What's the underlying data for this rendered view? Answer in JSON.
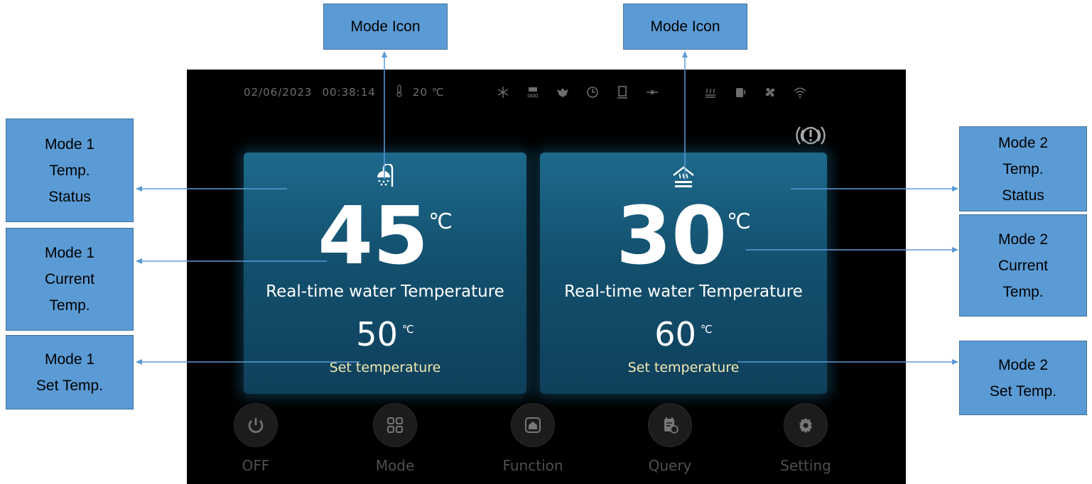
{
  "callouts": {
    "mode_icon_1": "Mode Icon",
    "mode_icon_2": "Mode Icon",
    "mode1_temp_status": "Mode 1\nTemp.\nStatus",
    "mode1_current_temp": "Mode 1\nCurrent\nTemp.",
    "mode1_set_temp": "Mode 1\nSet Temp.",
    "mode2_temp_status": "Mode 2\nTemp.\nStatus",
    "mode2_current_temp": "Mode 2\nCurrent\nTemp.",
    "mode2_set_temp": "Mode 2\nSet Temp."
  },
  "statusbar": {
    "date": "02/06/2023",
    "time": "00:38:14",
    "temp": "20 ℃"
  },
  "mode1": {
    "icon": "shower-icon",
    "current": "45",
    "current_unit": "℃",
    "realtime_label": "Real-time water Temperature",
    "set": "50",
    "set_unit": "℃",
    "set_label": "Set temperature"
  },
  "mode2": {
    "icon": "floor-heating-icon",
    "current": "30",
    "current_unit": "℃",
    "realtime_label": "Real-time water Temperature",
    "set": "60",
    "set_unit": "℃",
    "set_label": "Set temperature"
  },
  "nav": {
    "off": "OFF",
    "mode": "Mode",
    "function": "Function",
    "query": "Query",
    "setting": "Setting"
  },
  "colors": {
    "callout_fill": "#5b9bd5",
    "arrow": "#5b9bd5",
    "panel": "#13506e",
    "set_label": "#f4eab0"
  }
}
